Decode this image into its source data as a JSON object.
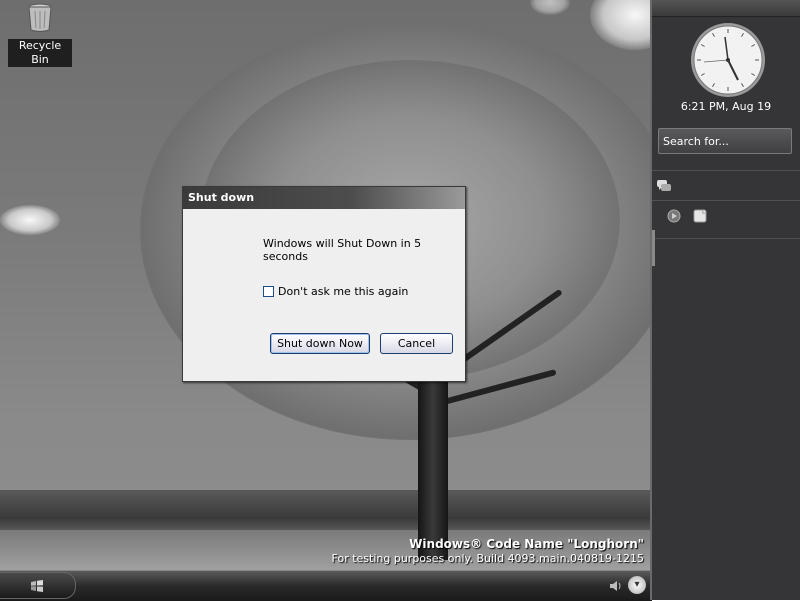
{
  "desktop": {
    "icons": [
      {
        "label": "Recycle Bin",
        "icon": "recycle-bin-icon"
      }
    ],
    "watermark": {
      "title": "Windows® Code Name \"Longhorn\"",
      "build": "For testing purposes only. Build 4093.main.040819-1215"
    }
  },
  "dialog": {
    "title": "Shut down",
    "message": "Windows will Shut Down in 5 seconds",
    "checkbox_label": "Don't ask me this again",
    "checkbox_checked": false,
    "primary_button": "Shut down Now",
    "cancel_button": "Cancel"
  },
  "sidebar": {
    "clock_label": "6:21 PM, Aug 19",
    "search_placeholder": "Search for...",
    "icons": [
      "chat-bubbles-icon",
      "media-icon",
      "note-icon"
    ]
  },
  "taskbar": {
    "start_icon": "windows-flag-icon",
    "tray": [
      "volume-icon",
      "expand-tray-icon"
    ]
  }
}
